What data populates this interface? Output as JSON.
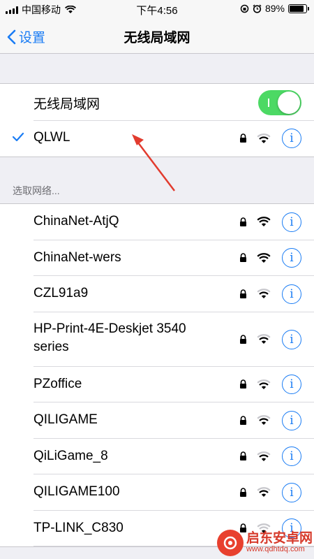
{
  "status_bar": {
    "carrier": "中国移动",
    "time": "下午4:56",
    "battery_percent": "89%",
    "battery_level": 0.89
  },
  "nav": {
    "back_label": "设置",
    "title": "无线局域网"
  },
  "wifi_toggle": {
    "label": "无线局域网",
    "on": true,
    "color": "#4cd964"
  },
  "connected": {
    "name": "QLWL",
    "locked": true
  },
  "section_header": "选取网络...",
  "networks": [
    {
      "name": "ChinaNet-AtjQ",
      "locked": true,
      "strength": "strong"
    },
    {
      "name": "ChinaNet-wers",
      "locked": true,
      "strength": "strong"
    },
    {
      "name": "CZL91a9",
      "locked": true,
      "strength": "medium"
    },
    {
      "name": "HP-Print-4E-Deskjet 3540 series",
      "locked": true,
      "strength": "medium"
    },
    {
      "name": "PZoffice",
      "locked": true,
      "strength": "medium"
    },
    {
      "name": "QILIGAME",
      "locked": true,
      "strength": "medium"
    },
    {
      "name": "QiLiGame_8",
      "locked": true,
      "strength": "medium"
    },
    {
      "name": "QILIGAME100",
      "locked": true,
      "strength": "medium"
    },
    {
      "name": "TP-LINK_C830",
      "locked": true,
      "strength": "weak"
    }
  ],
  "info_glyph": "i",
  "accent_color": "#1a7cf4",
  "watermark": {
    "title": "启东安卓网",
    "url": "www.qdhtdq.com"
  }
}
